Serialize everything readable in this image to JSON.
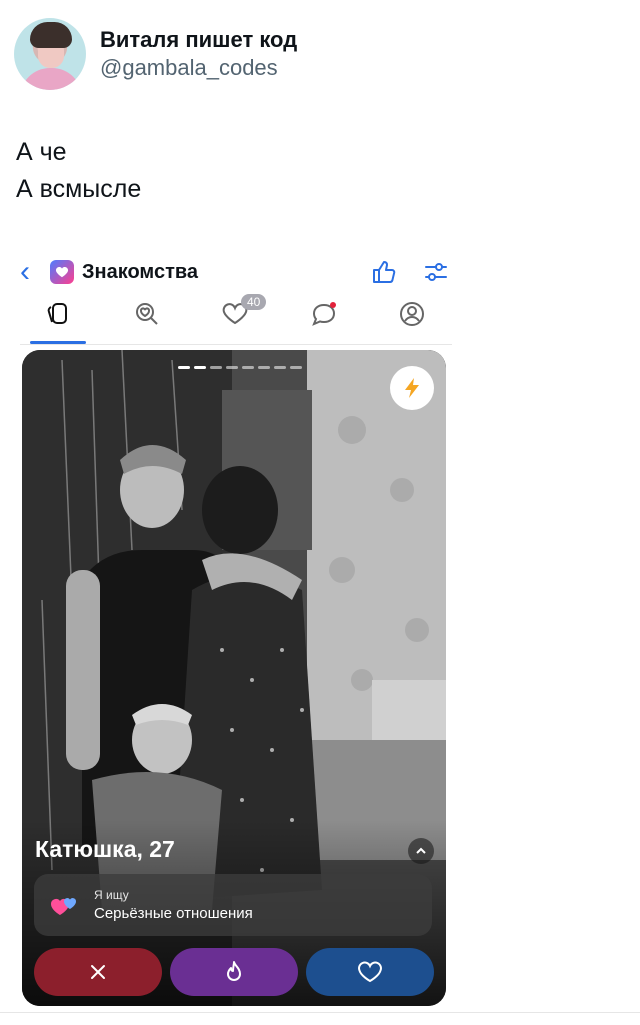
{
  "tweet": {
    "display_name": "Виталя пишет код",
    "handle": "@gambala_codes",
    "text_lines": [
      "А че",
      "А всмысле"
    ]
  },
  "app": {
    "title": "Знакомства",
    "tabs": [
      {
        "icon": "cards-icon",
        "active": true
      },
      {
        "icon": "search-heart-icon"
      },
      {
        "icon": "likes-heart-icon",
        "badge": "40"
      },
      {
        "icon": "chat-bubble-icon",
        "dot": true
      },
      {
        "icon": "profile-icon"
      }
    ],
    "profile": {
      "name_age": "Катюшка, 27",
      "looking_label": "Я ищу",
      "looking_value": "Серьёзные отношения"
    },
    "colors": {
      "accent": "#2b6fe3",
      "dislike": "#8c1f2c",
      "super": "#6a2f93",
      "like": "#1d4f8f",
      "boost": "#f5a623"
    }
  }
}
